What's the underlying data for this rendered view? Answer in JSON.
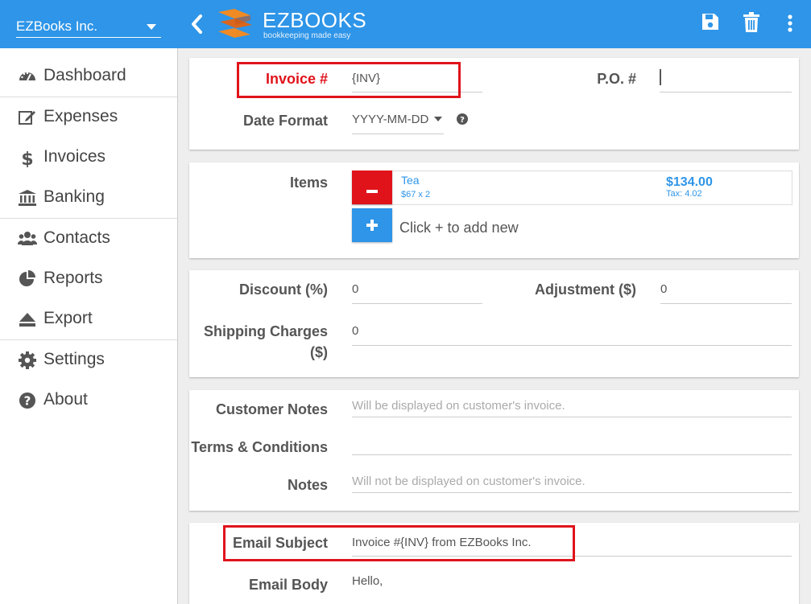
{
  "topbar": {
    "company": "EZBooks Inc.",
    "brand": "EZBOOKS",
    "tagline": "bookkeeping made easy",
    "icons": [
      "back-chevron-icon",
      "ezbooks-logo",
      "save-icon",
      "trash-icon",
      "more-vert-icon"
    ]
  },
  "colors": {
    "accent": "#2e95e8",
    "danger": "#e0131b",
    "link": "#2e95e8"
  },
  "sidebar": {
    "items": [
      {
        "label": "Dashboard",
        "icon": "dashboard-icon"
      },
      {
        "label": "Expenses",
        "icon": "edit-icon"
      },
      {
        "label": "Invoices",
        "icon": "dollar-icon"
      },
      {
        "label": "Banking",
        "icon": "bank-icon"
      },
      {
        "label": "Contacts",
        "icon": "users-icon"
      },
      {
        "label": "Reports",
        "icon": "pie-chart-icon"
      },
      {
        "label": "Export",
        "icon": "eject-icon"
      },
      {
        "label": "Settings",
        "icon": "gear-icon"
      },
      {
        "label": "About",
        "icon": "question-icon"
      }
    ]
  },
  "form": {
    "invoice_label": "Invoice #",
    "invoice_value": "{INV}",
    "po_label": "P.O. #",
    "po_value": "",
    "date_format_label": "Date Format",
    "date_format_value": "YYYY-MM-DD",
    "items_label": "Items",
    "item": {
      "name": "Tea",
      "detail": "$67 x 2",
      "amount": "$134.00",
      "tax": "Tax: 4.02"
    },
    "add_hint": "Click + to add new",
    "discount_label": "Discount (%)",
    "discount_value": "0",
    "adjustment_label": "Adjustment ($)",
    "adjustment_value": "0",
    "shipping_label_1": "Shipping Charges",
    "shipping_label_2": "($)",
    "shipping_value": "0",
    "customer_notes_label": "Customer Notes",
    "customer_notes_placeholder": "Will be displayed on customer's invoice.",
    "terms_label": "Terms & Conditions",
    "terms_value": "",
    "notes_label": "Notes",
    "notes_placeholder": "Will not be displayed on customer's invoice.",
    "email_subject_label": "Email Subject",
    "email_subject_value": "Invoice #{INV} from EZBooks Inc.",
    "email_body_label": "Email Body",
    "email_body_value": "Hello,"
  }
}
